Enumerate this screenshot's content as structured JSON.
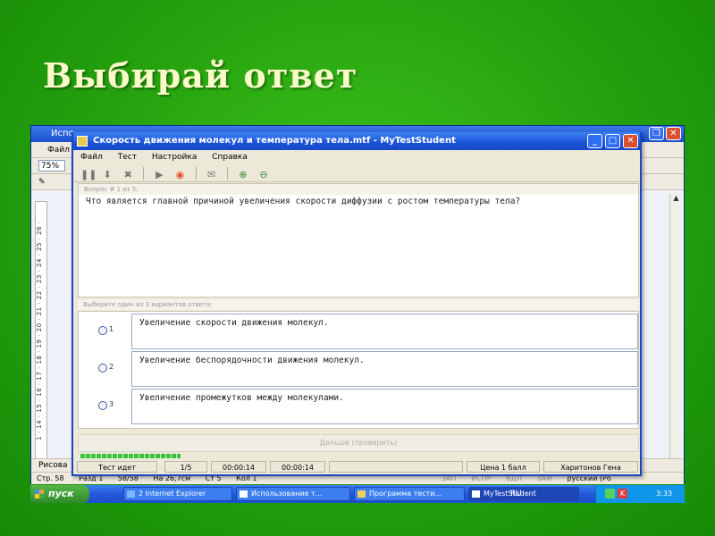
{
  "slide": {
    "title": "Выбирай ответ"
  },
  "word": {
    "title": "Испо",
    "menu_file": "Файл",
    "zoom": "75%",
    "ruler": "1 · 14 · 15 · 16 · 17 · 18 · 19 · 20 · 21 · 22 · 23 · 24 · 25 · 26 ·",
    "draw_label": "Рисова",
    "status": [
      "Стр. 58",
      "Разд 1",
      "58/58",
      "На 26,7см",
      "Ст 5",
      "Кол 1",
      "ЗАП",
      "ИСПР",
      "ВДЛ",
      "ЗАМ",
      "русский (Ро"
    ]
  },
  "dialog": {
    "title": "Скорость движения молекул и температура тела.mtf - MyTestStudent",
    "menu": [
      "Файл",
      "Тест",
      "Настройка",
      "Справка"
    ],
    "question_header": "Вопрос # 1 из 5:",
    "question": "Что является главной причиной увеличения скорости диффузии с ростом температуры тела?",
    "answers_header": "Выберите один из 3 вариантов ответа:",
    "answers": [
      {
        "num": "1",
        "text": "Увеличение скорости движения молекул."
      },
      {
        "num": "2",
        "text": "Увеличение беспорядочности движения молекул."
      },
      {
        "num": "3",
        "text": "Увеличение промежутков между молекулами."
      }
    ],
    "next_button": "Дальше (проверить)",
    "status": {
      "state": "Тест идет",
      "progress": "1/5",
      "time1": "00:00:14",
      "time2": "00:00:14",
      "score": "Цена 1 балл",
      "user": "Харитонов Гена"
    }
  },
  "taskbar": {
    "start": "пуск",
    "tasks": [
      "2 Internet Explorer",
      "Использование т...",
      "Программа тести...",
      "MyTestStudent"
    ],
    "lang": "RU",
    "clock": "3:33"
  }
}
